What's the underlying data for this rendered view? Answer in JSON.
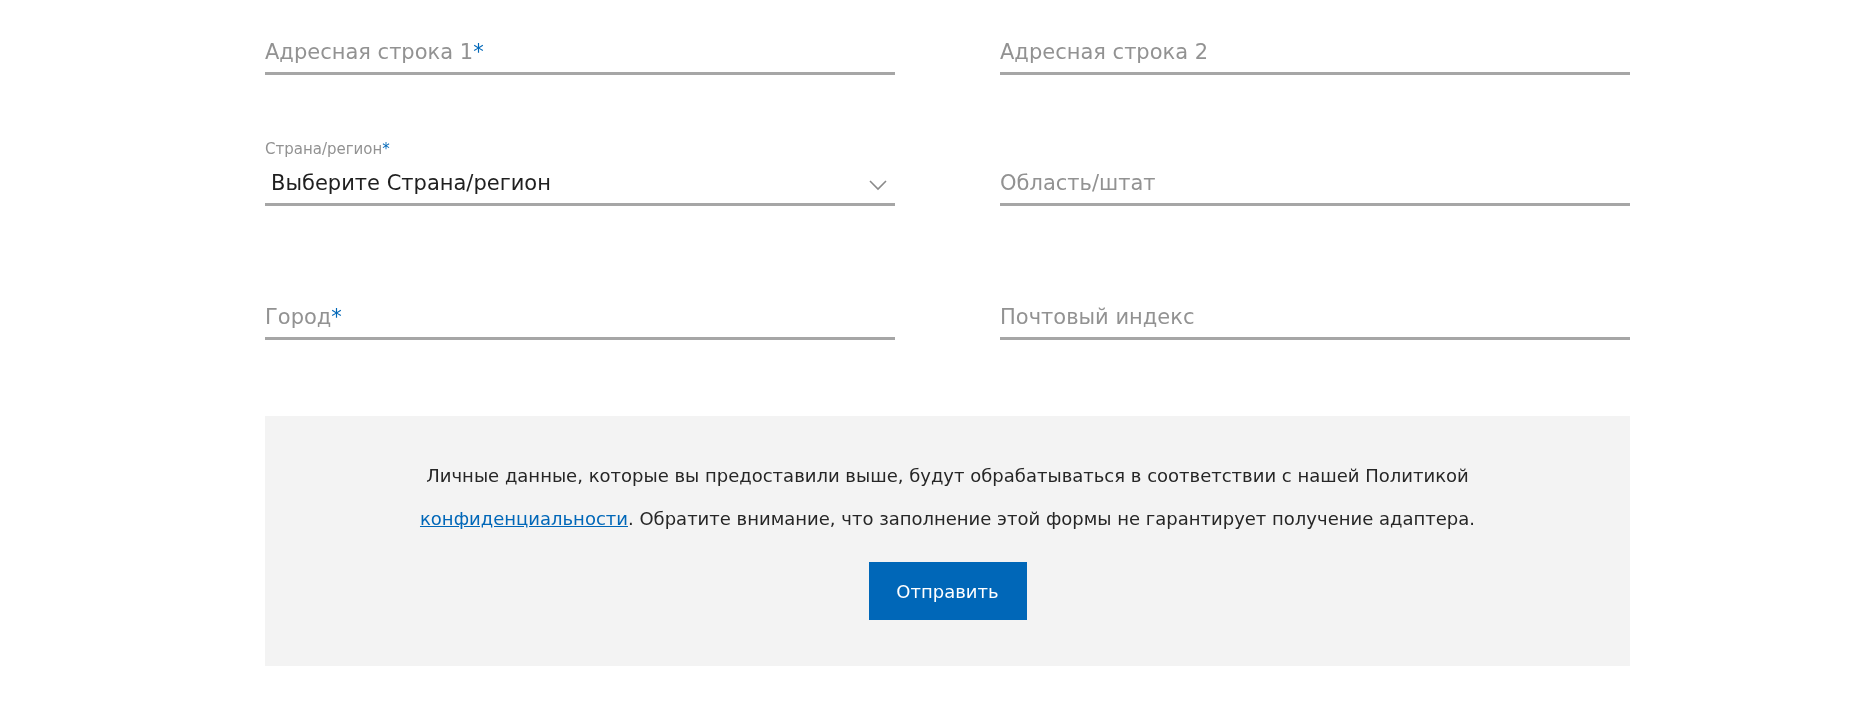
{
  "fields": [
    {
      "kind": "text",
      "placeholder": "Адресная строка 1",
      "required_mark": "*"
    },
    {
      "kind": "text",
      "placeholder": "Адресная строка 2"
    },
    {
      "kind": "select",
      "label": "Страна/регион",
      "required_mark": "*",
      "value": "Выберите Страна/регион"
    },
    {
      "kind": "text",
      "placeholder": "Область/штат"
    },
    {
      "kind": "text",
      "placeholder": "Город",
      "required_mark": "*"
    },
    {
      "kind": "text",
      "placeholder": "Почтовый индекс"
    }
  ],
  "notice": {
    "text_before": "Личные данные, которые вы предоставили выше, будут обрабатываться в соответствии с нашей Политикой",
    "link": "конфиденциальности",
    "text_after": ". Обратите внимание, что заполнение этой формы не гарантирует получение адаптера."
  },
  "submit_button": "Отправить"
}
